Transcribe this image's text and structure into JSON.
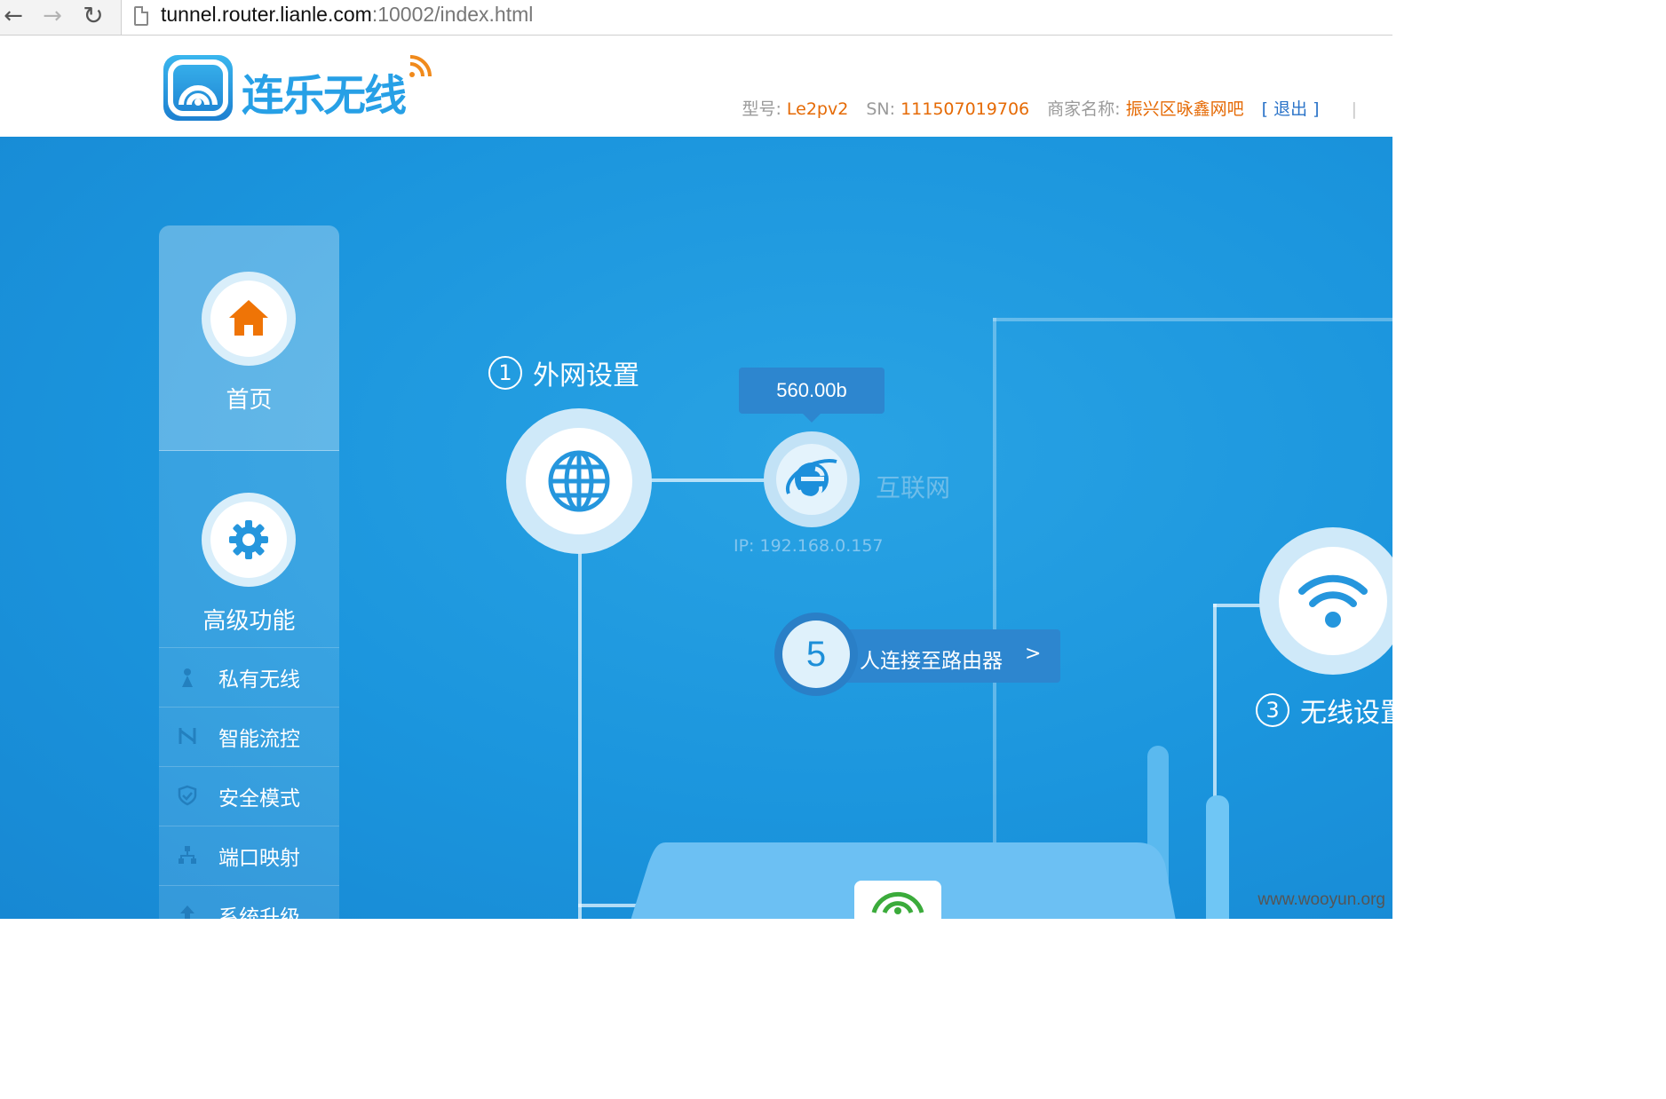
{
  "browser": {
    "url_host": "tunnel.router.lianle.com",
    "url_rest": ":10002/index.html"
  },
  "header": {
    "brand": "连乐无线",
    "model_label": "型号:",
    "model_value": "Le2pv2",
    "sn_label": "SN:",
    "sn_value": "111507019706",
    "merchant_label": "商家名称:",
    "merchant_value": "振兴区咏鑫网吧",
    "logout": "[ 退出 ]",
    "separator": "|"
  },
  "sidebar": {
    "home": {
      "label": "首页",
      "icon": "home-icon"
    },
    "advanced": {
      "label": "高级功能",
      "icon": "gear-icon"
    },
    "items": [
      {
        "label": "私有无线",
        "icon": "private-wifi-icon"
      },
      {
        "label": "智能流控",
        "icon": "flow-control-icon"
      },
      {
        "label": "安全模式",
        "icon": "shield-icon"
      },
      {
        "label": "端口映射",
        "icon": "network-tree-icon"
      },
      {
        "label": "系统升级",
        "icon": "upgrade-icon"
      }
    ]
  },
  "dashboard": {
    "wan": {
      "step": "1",
      "title": "外网设置",
      "icon": "globe-icon"
    },
    "internet": {
      "traffic": "560.00b",
      "label": "互联网",
      "ip": "IP:  192.168.0.157",
      "icon": "ie-icon"
    },
    "clients": {
      "count": "5",
      "text": "人连接至路由器",
      "arrow": ">"
    },
    "wireless": {
      "step": "3",
      "title": "无线设置",
      "icon": "wifi-icon"
    }
  },
  "watermark": "www.wooyun.org",
  "colors": {
    "brand_blue": "#27a0e6",
    "background_blue": "#1b95dd",
    "accent_orange": "#e56a05",
    "logout_blue": "#2a73c8"
  }
}
